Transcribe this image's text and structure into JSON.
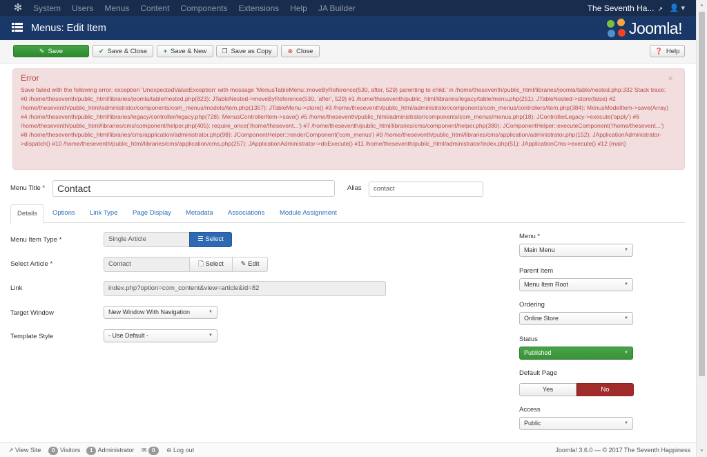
{
  "topnav": {
    "logo_icon": "joomla-icon",
    "menu": [
      "System",
      "Users",
      "Menus",
      "Content",
      "Components",
      "Extensions",
      "Help",
      "JA Builder"
    ],
    "site_name": "The Seventh Ha...",
    "user_icon": "user-icon"
  },
  "header": {
    "title": "Menus: Edit Item",
    "brand": "Joomla!"
  },
  "toolbar": {
    "save": "Save",
    "save_close": "Save & Close",
    "save_new": "Save & New",
    "save_copy": "Save as Copy",
    "close": "Close",
    "help": "Help"
  },
  "alert": {
    "heading": "Error",
    "message": "Save failed with the following error: exception 'UnexpectedValueException' with message 'MenusTableMenu::moveByReference(530, after, 529) parenting to child.' in /home/theseventh/public_html/libraries/joomla/table/nested.php:332 Stack trace: #0 /home/theseventh/public_html/libraries/joomla/table/nested.php(823): JTableNested->moveByReference(530, 'after', 529) #1 /home/theseventh/public_html/libraries/legacy/table/menu.php(251): JTableNested->store(false) #2 /home/theseventh/public_html/administrator/components/com_menus/models/item.php(1357): JTableMenu->store() #3 /home/theseventh/public_html/administrator/components/com_menus/controllers/item.php(384): MenusModelItem->save(Array) #4 /home/theseventh/public_html/libraries/legacy/controller/legacy.php(728): MenusControllerItem->save() #5 /home/theseventh/public_html/administrator/components/com_menus/menus.php(18): JControllerLegacy->execute('apply') #6 /home/theseventh/public_html/libraries/cms/component/helper.php(405): require_once('/home/thesevent...') #7 /home/theseventh/public_html/libraries/cms/component/helper.php(380): JComponentHelper::executeComponent('/home/thesevent...') #8 /home/theseventh/public_html/libraries/cms/application/administrator.php(98): JComponentHelper::renderComponent('com_menus') #9 /home/theseventh/public_html/libraries/cms/application/administrator.php(152): JApplicationAdministrator->dispatch() #10 /home/theseventh/public_html/libraries/cms/application/cms.php(257): JApplicationAdministrator->doExecute() #11 /home/theseventh/public_html/administrator/index.php(51): JApplicationCms->execute() #12 {main}"
  },
  "form": {
    "menu_title_label": "Menu Title *",
    "menu_title_value": "Contact",
    "alias_label": "Alias",
    "alias_value": "contact"
  },
  "tabs": [
    "Details",
    "Options",
    "Link Type",
    "Page Display",
    "Metadata",
    "Associations",
    "Module Assignment"
  ],
  "details": {
    "menu_item_type_label": "Menu Item Type *",
    "menu_item_type_value": "Single Article",
    "select_label": "Select",
    "select_article_label": "Select Article *",
    "select_article_value": "Contact",
    "edit_label": "Edit",
    "link_label": "Link",
    "link_value": "index.php?option=com_content&view=article&id=82",
    "target_window_label": "Target Window",
    "target_window_value": "New Window With Navigation",
    "template_style_label": "Template Style",
    "template_style_value": "- Use Default -"
  },
  "sidebar": {
    "menu_label": "Menu *",
    "menu_value": "Main Menu",
    "parent_label": "Parent Item",
    "parent_value": "Menu Item Root",
    "ordering_label": "Ordering",
    "ordering_value": "Online Store",
    "status_label": "Status",
    "status_value": "Published",
    "default_page_label": "Default Page",
    "default_yes": "Yes",
    "default_no": "No",
    "access_label": "Access",
    "access_value": "Public"
  },
  "statusbar": {
    "view_site": "View Site",
    "visitors_count": "0",
    "visitors": "Visitors",
    "admin_count": "1",
    "admin": "Administrator",
    "messages_count": "0",
    "logout": "Log out",
    "version": "Joomla! 3.6.0",
    "copyright": "— © 2017 The Seventh Happiness"
  },
  "colors": {
    "topnav": "#182c4e",
    "header": "#1a3867",
    "success": "#3c9a3c",
    "danger": "#a12a2a",
    "primary": "#2e6ab3",
    "alert_bg": "#f2dede",
    "alert_text": "#b94a48"
  }
}
